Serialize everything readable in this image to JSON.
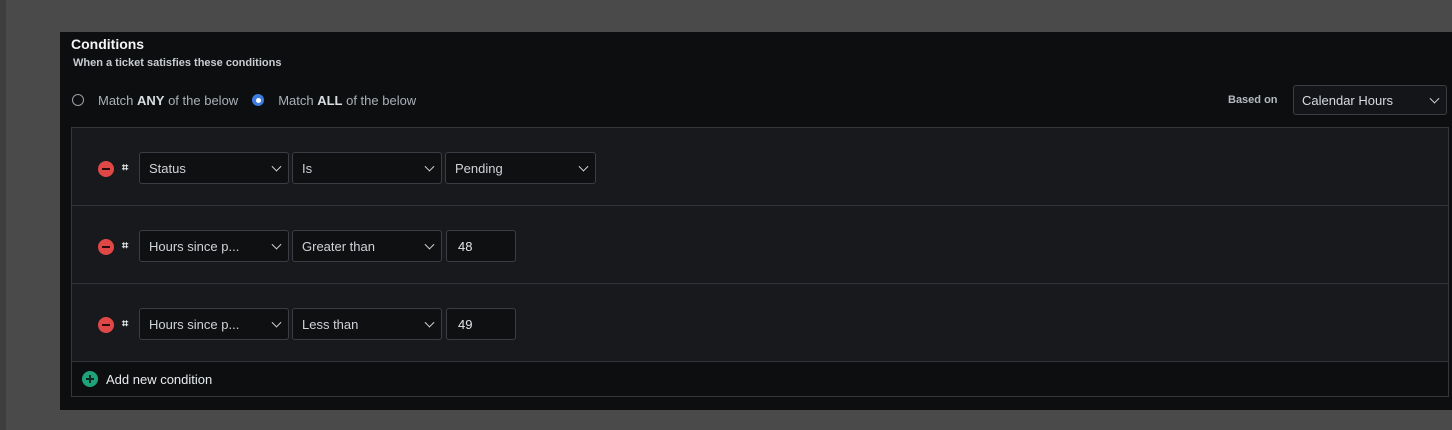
{
  "conditions": {
    "title": "Conditions",
    "subtitle": "When a ticket satisfies these conditions",
    "match_any": {
      "prefix": "Match ",
      "bold": "ANY",
      "suffix": " of the below",
      "checked": false
    },
    "match_all": {
      "prefix": "Match ",
      "bold": "ALL",
      "suffix": " of the below",
      "checked": true
    },
    "based_on_label": "Based on",
    "based_on_value": "Calendar Hours",
    "rows": [
      {
        "field": "Status",
        "operator": "Is",
        "value": "Pending",
        "value_type": "select"
      },
      {
        "field": "Hours since p...",
        "operator": "Greater than",
        "value": "48",
        "value_type": "input"
      },
      {
        "field": "Hours since p...",
        "operator": "Less than",
        "value": "49",
        "value_type": "input"
      }
    ],
    "hash_symbol": "⌗",
    "add_label": "Add new condition"
  },
  "colors": {
    "remove": "#e04848",
    "add": "#1fa27a",
    "radio_checked": "#3d7be0"
  },
  "icons": {
    "remove": "minus-circle-icon",
    "hash": "hash-icon",
    "add": "plus-circle-icon",
    "chevron": "chevron-down-icon"
  }
}
